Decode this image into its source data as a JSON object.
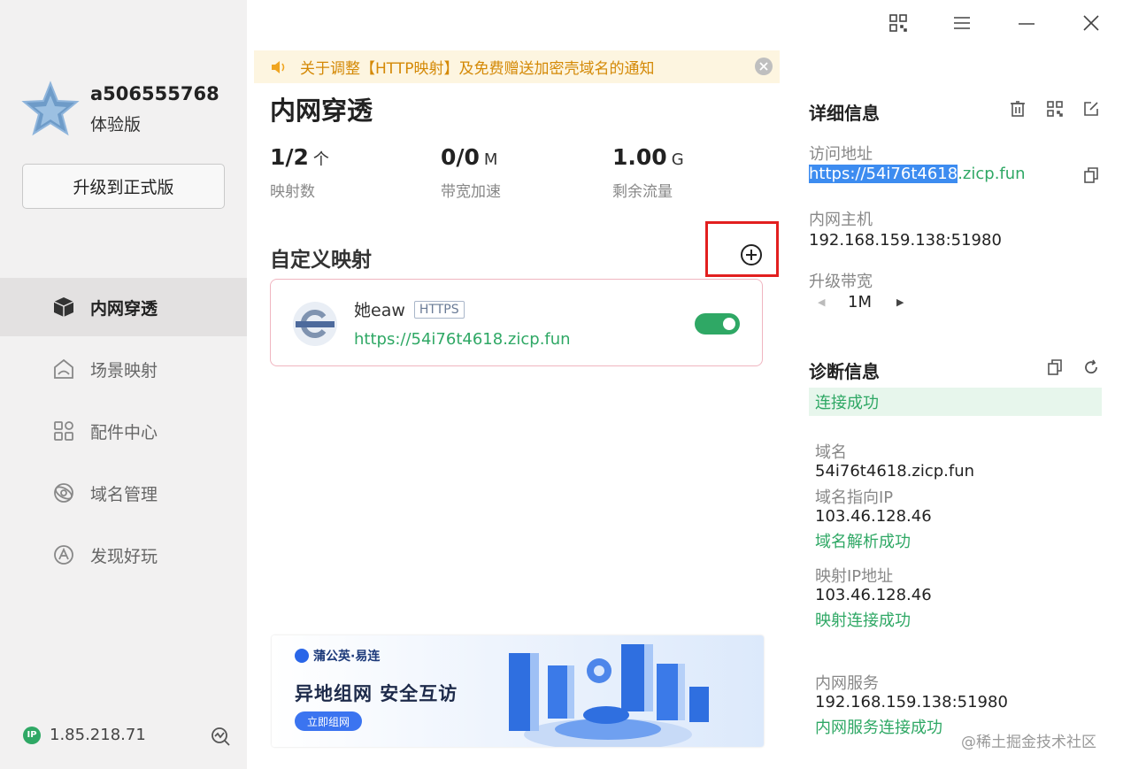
{
  "user": {
    "name": "a506555768",
    "plan": "体验版",
    "upgrade_label": "升级到正式版"
  },
  "nav": [
    {
      "label": "内网穿透",
      "active": true,
      "icon": "cube-icon"
    },
    {
      "label": "场景映射",
      "active": false,
      "icon": "scene-icon"
    },
    {
      "label": "配件中心",
      "active": false,
      "icon": "grid-icon"
    },
    {
      "label": "域名管理",
      "active": false,
      "icon": "globe-icon"
    },
    {
      "label": "发现好玩",
      "active": false,
      "icon": "compass-icon"
    }
  ],
  "footer": {
    "ip": "1.85.218.71",
    "ip_badge": "IP"
  },
  "notice": {
    "text": "关于调整【HTTP映射】及免费赠送加密壳域名的通知"
  },
  "main": {
    "title": "内网穿透",
    "stats": [
      {
        "value": "1/2",
        "unit": "个",
        "label": "映射数"
      },
      {
        "value": "0/0",
        "unit": "M",
        "label": "带宽加速"
      },
      {
        "value": "1.00",
        "unit": "G",
        "label": "剩余流量"
      }
    ],
    "section_title": "自定义映射",
    "mapping": {
      "name": "她eaw",
      "protocol": "HTTPS",
      "url": "https://54i76t4618.zicp.fun",
      "enabled": true
    }
  },
  "banner": {
    "brand": "蒲公英·易连",
    "slogan": "异地组网  安全互访",
    "button": "立即组网"
  },
  "details": {
    "title": "详细信息",
    "access_label": "访问地址",
    "access_url_selected": "https://54i76t4618",
    "access_url_rest": ".zicp.fun",
    "host_label": "内网主机",
    "host_value": "192.168.159.138:51980",
    "bandwidth_label": "升级带宽",
    "bandwidth_value": "1M"
  },
  "diagnosis": {
    "title": "诊断信息",
    "status": "连接成功",
    "domain_label": "域名",
    "domain_value": "54i76t4618.zicp.fun",
    "domain_ip_label": "域名指向IP",
    "domain_ip_value": "103.46.128.46",
    "domain_ok": "域名解析成功",
    "map_ip_label": "映射IP地址",
    "map_ip_value": "103.46.128.46",
    "map_ok": "映射连接成功",
    "service_label": "内网服务",
    "service_value": "192.168.159.138:51980",
    "service_ok": "内网服务连接成功"
  },
  "watermark": "@稀土掘金技术社区",
  "colors": {
    "accent_green": "#2fa865",
    "notice_orange": "#d48906",
    "highlight_red": "#e21f1f"
  }
}
